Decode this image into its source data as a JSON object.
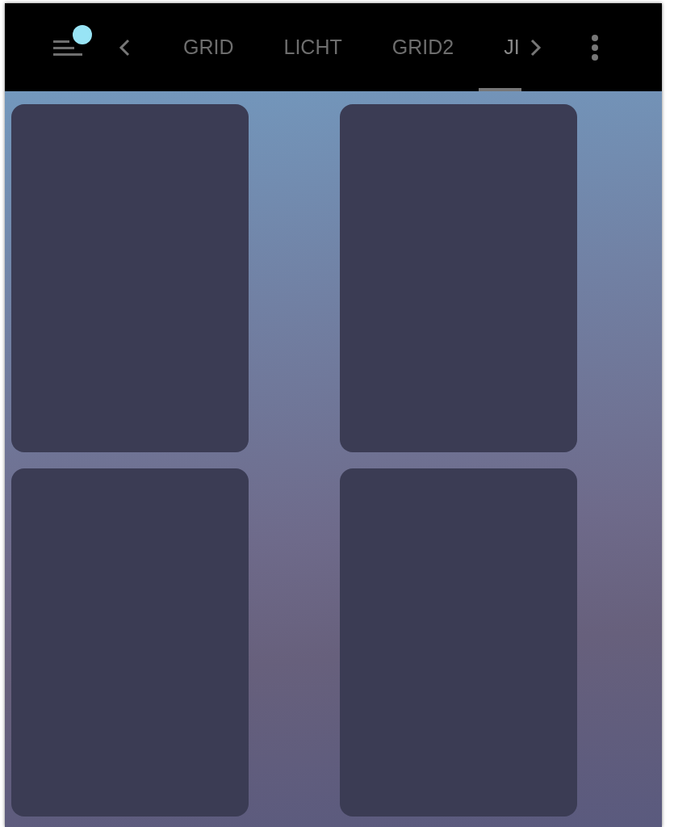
{
  "toolbar": {
    "menu_badge": true,
    "tabs": [
      {
        "label": "GRID",
        "selected": false
      },
      {
        "label": "LICHT",
        "selected": false
      },
      {
        "label": "GRID2",
        "selected": false
      },
      {
        "label": "JI",
        "selected": true
      }
    ]
  },
  "cards": [
    {
      "kind": "empty"
    },
    {
      "kind": "empty"
    },
    {
      "kind": "empty"
    },
    {
      "kind": "empty"
    }
  ]
}
